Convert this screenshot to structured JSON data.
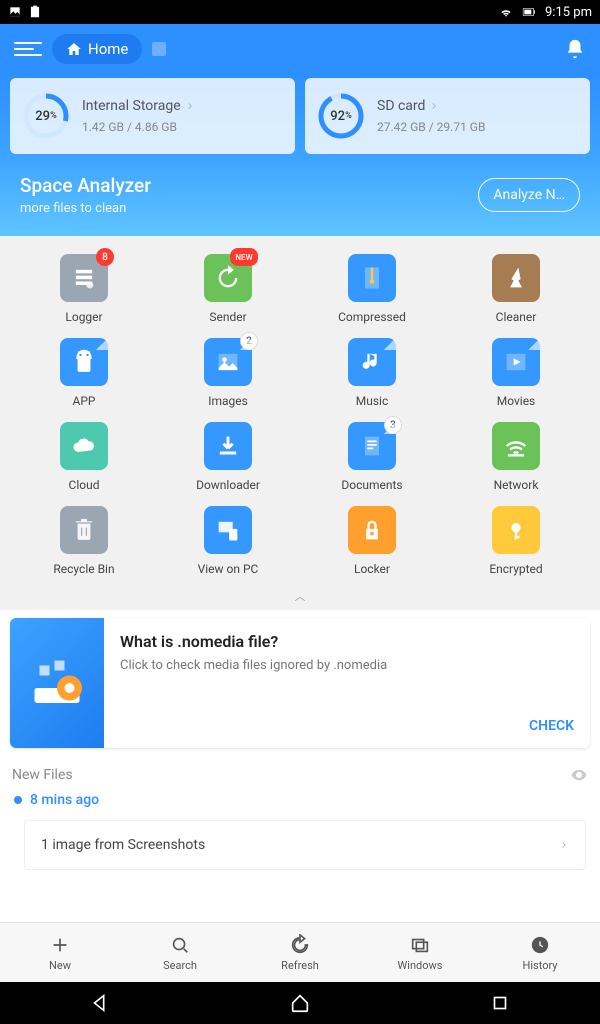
{
  "status": {
    "time": "9:15 pm"
  },
  "header": {
    "home": "Home"
  },
  "storage": [
    {
      "name": "Internal Storage",
      "pct": 29,
      "used": "1.42 GB",
      "total": "4.86 GB"
    },
    {
      "name": "SD card",
      "pct": 92,
      "used": "27.42 GB",
      "total": "29.71 GB"
    }
  ],
  "analyzer": {
    "title": "Space Analyzer",
    "sub": "more files to clean",
    "btn": "Analyze N…"
  },
  "tiles": [
    {
      "label": "Logger",
      "color": "#9aa6b2",
      "badge": "8",
      "icon": "stack"
    },
    {
      "label": "Sender",
      "color": "#6ac259",
      "badge": "NEW",
      "badgeType": "new",
      "icon": "refresh"
    },
    {
      "label": "Compressed",
      "color": "#3498ff",
      "icon": "zip"
    },
    {
      "label": "Cleaner",
      "color": "#a67c52",
      "icon": "broom"
    },
    {
      "label": "APP",
      "color": "#3498ff",
      "fold": true,
      "icon": "android"
    },
    {
      "label": "Images",
      "color": "#3498ff",
      "badge": "2",
      "badgeType": "white",
      "fold": true,
      "icon": "image"
    },
    {
      "label": "Music",
      "color": "#3498ff",
      "fold": true,
      "icon": "music"
    },
    {
      "label": "Movies",
      "color": "#3498ff",
      "fold": true,
      "icon": "movie"
    },
    {
      "label": "Cloud",
      "color": "#4dc9b0",
      "icon": "cloud"
    },
    {
      "label": "Downloader",
      "color": "#3498ff",
      "icon": "download"
    },
    {
      "label": "Documents",
      "color": "#3498ff",
      "badge": "3",
      "badgeType": "white",
      "fold": true,
      "icon": "doc"
    },
    {
      "label": "Network",
      "color": "#6ac259",
      "icon": "wifi"
    },
    {
      "label": "Recycle Bin",
      "color": "#9aa6b2",
      "icon": "trash"
    },
    {
      "label": "View on PC",
      "color": "#3498ff",
      "icon": "pc"
    },
    {
      "label": "Locker",
      "color": "#ff9f2e",
      "icon": "lock"
    },
    {
      "label": "Encrypted",
      "color": "#ffc93c",
      "icon": "key"
    }
  ],
  "promo": {
    "title": "What is .nomedia file?",
    "desc": "Click to check media files ignored by .nomedia",
    "action": "CHECK"
  },
  "newfiles": {
    "header": "New Files",
    "time": "8 mins ago",
    "item": "1 image from Screenshots"
  },
  "bottom": [
    {
      "label": "New",
      "icon": "plus"
    },
    {
      "label": "Search",
      "icon": "search"
    },
    {
      "label": "Refresh",
      "icon": "refresh"
    },
    {
      "label": "Windows",
      "icon": "windows"
    },
    {
      "label": "History",
      "icon": "clock"
    }
  ]
}
